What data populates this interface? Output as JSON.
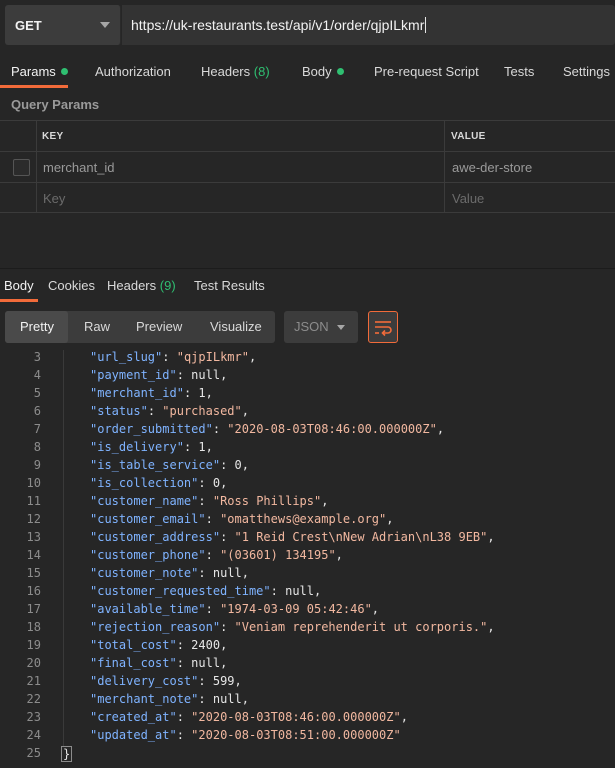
{
  "request": {
    "method": "GET",
    "url": "https://uk-restaurants.test/api/v1/order/qjpILkmr"
  },
  "request_tabs": {
    "params": "Params",
    "authorization": "Authorization",
    "headers": "Headers",
    "headers_count": "(8)",
    "body": "Body",
    "pre_request": "Pre-request Script",
    "tests": "Tests",
    "settings": "Settings"
  },
  "query_params": {
    "label": "Query Params",
    "col_key": "KEY",
    "col_value": "VALUE",
    "rows": [
      {
        "key": "merchant_id",
        "value": "awe-der-store"
      }
    ],
    "placeholder_key": "Key",
    "placeholder_value": "Value"
  },
  "response_tabs": {
    "body": "Body",
    "cookies": "Cookies",
    "headers": "Headers",
    "headers_count": "(9)",
    "test_results": "Test Results"
  },
  "response_toolbar": {
    "pretty": "Pretty",
    "raw": "Raw",
    "preview": "Preview",
    "visualize": "Visualize",
    "format": "JSON"
  },
  "response_lines": [
    {
      "n": "3",
      "key": "url_slug",
      "value": "\"qjpILkmr\"",
      "kind": "s"
    },
    {
      "n": "4",
      "key": "payment_id",
      "value": "null",
      "kind": "n"
    },
    {
      "n": "5",
      "key": "merchant_id",
      "value": "1",
      "kind": "n"
    },
    {
      "n": "6",
      "key": "status",
      "value": "\"purchased\"",
      "kind": "s"
    },
    {
      "n": "7",
      "key": "order_submitted",
      "value": "\"2020-08-03T08:46:00.000000Z\"",
      "kind": "s"
    },
    {
      "n": "8",
      "key": "is_delivery",
      "value": "1",
      "kind": "n"
    },
    {
      "n": "9",
      "key": "is_table_service",
      "value": "0",
      "kind": "n"
    },
    {
      "n": "10",
      "key": "is_collection",
      "value": "0",
      "kind": "n"
    },
    {
      "n": "11",
      "key": "customer_name",
      "value": "\"Ross Phillips\"",
      "kind": "s"
    },
    {
      "n": "12",
      "key": "customer_email",
      "value": "\"omatthews@example.org\"",
      "kind": "s"
    },
    {
      "n": "13",
      "key": "customer_address",
      "value": "\"1 Reid Crest\\nNew Adrian\\nL38 9EB\"",
      "kind": "s"
    },
    {
      "n": "14",
      "key": "customer_phone",
      "value": "\"(03601) 134195\"",
      "kind": "s"
    },
    {
      "n": "15",
      "key": "customer_note",
      "value": "null",
      "kind": "n"
    },
    {
      "n": "16",
      "key": "customer_requested_time",
      "value": "null",
      "kind": "n"
    },
    {
      "n": "17",
      "key": "available_time",
      "value": "\"1974-03-09 05:42:46\"",
      "kind": "s"
    },
    {
      "n": "18",
      "key": "rejection_reason",
      "value": "\"Veniam reprehenderit ut corporis.\"",
      "kind": "s"
    },
    {
      "n": "19",
      "key": "total_cost",
      "value": "2400",
      "kind": "n"
    },
    {
      "n": "20",
      "key": "final_cost",
      "value": "null",
      "kind": "n"
    },
    {
      "n": "21",
      "key": "delivery_cost",
      "value": "599",
      "kind": "n"
    },
    {
      "n": "22",
      "key": "merchant_note",
      "value": "null",
      "kind": "n"
    },
    {
      "n": "23",
      "key": "created_at",
      "value": "\"2020-08-03T08:46:00.000000Z\"",
      "kind": "s"
    },
    {
      "n": "24",
      "key": "updated_at",
      "value": "\"2020-08-03T08:51:00.000000Z\"",
      "kind": "s",
      "last": true
    }
  ],
  "closing_line": {
    "n": "25",
    "text": "}"
  },
  "colors": {
    "accent": "#f26b3a",
    "success": "#2fbf71",
    "json_key": "#7fb3ff",
    "json_string": "#f2b8a0"
  }
}
